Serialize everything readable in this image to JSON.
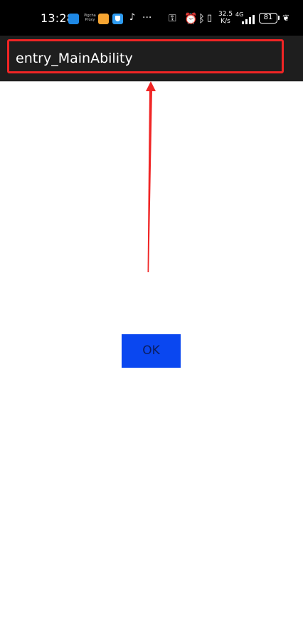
{
  "status_bar": {
    "time": "13:28",
    "app_icons": [
      "app-blue-icon",
      "app-tiny-text-icon",
      "app-orange-icon",
      "shield-app-icon",
      "tiktok-icon"
    ],
    "tiny_app_text": "Pigcha Proxy",
    "more": "···",
    "system_icons": [
      "key-icon",
      "alarm-icon",
      "bluetooth-icon",
      "vibrate-icon"
    ],
    "speed_value": "32.5",
    "speed_unit": "K/s",
    "network": "4G",
    "battery_level": "81",
    "signal_bars": 4
  },
  "title_bar": {
    "title": "entry_MainAbility"
  },
  "dialog": {
    "ok_label": "OK"
  },
  "colors": {
    "status_bg": "#000000",
    "title_bg": "#1e1e1e",
    "highlight": "#f02525",
    "ok_bg": "#0a47f0",
    "ok_text": "#0b1d5e"
  }
}
